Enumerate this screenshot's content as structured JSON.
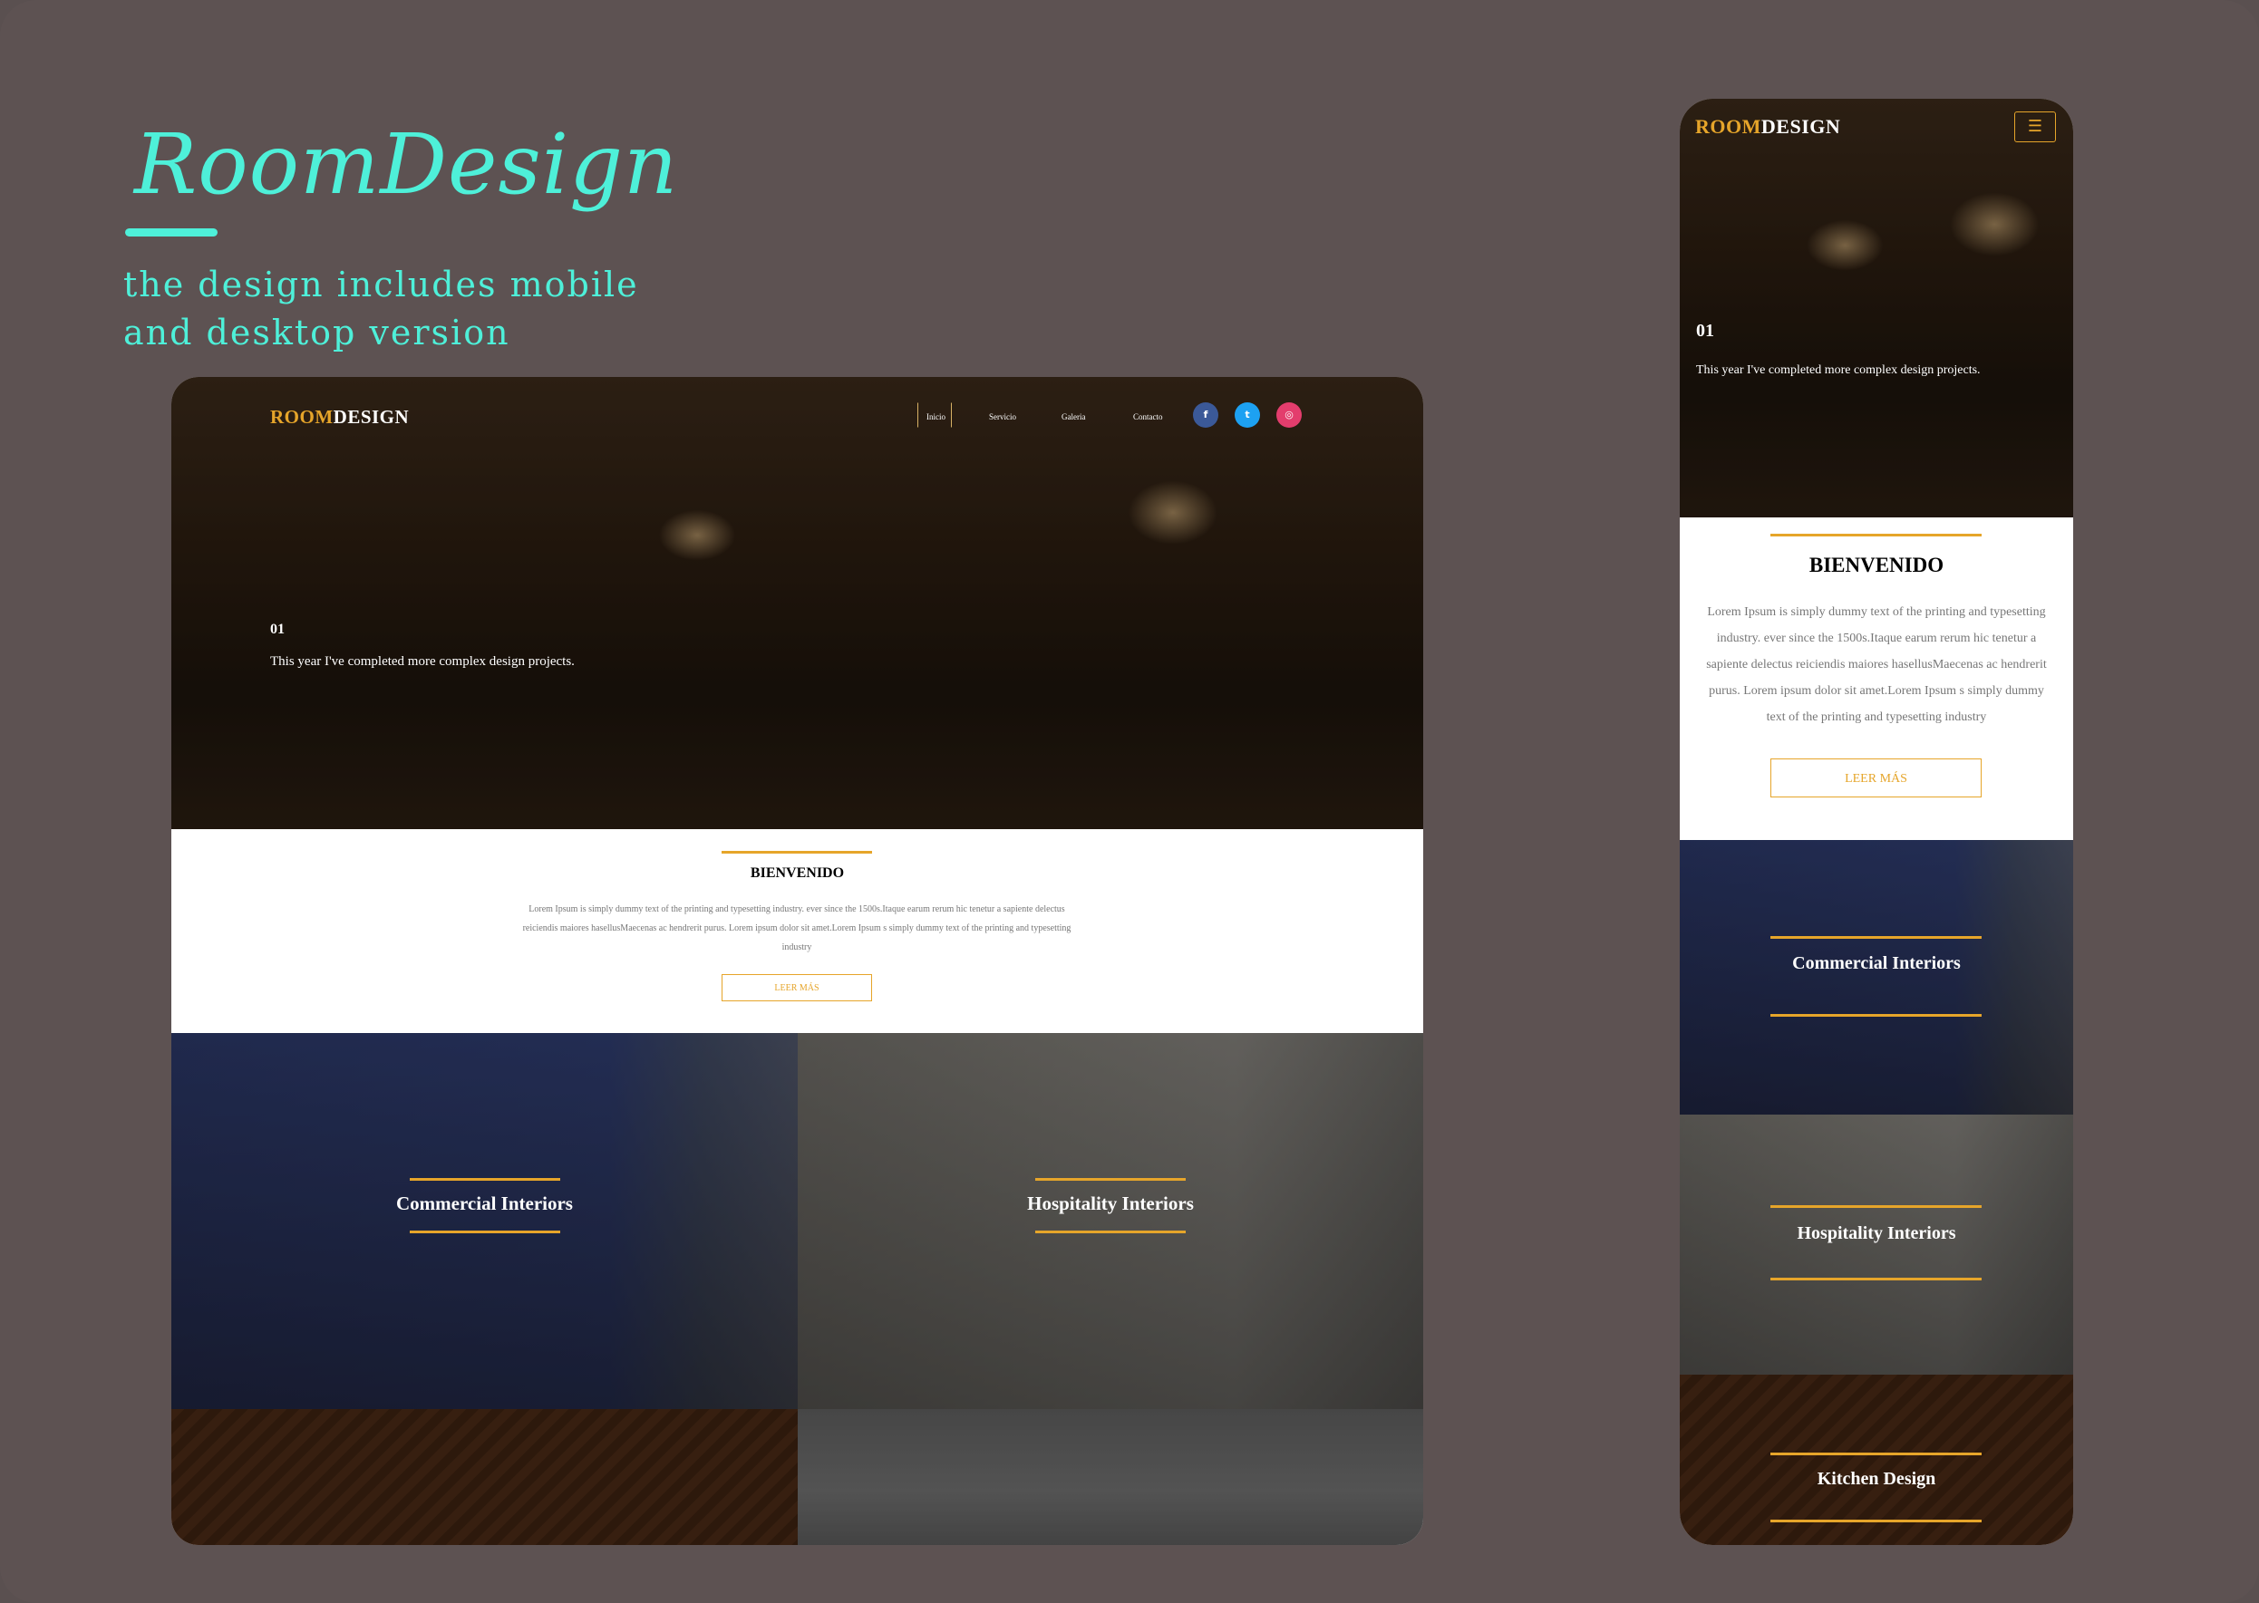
{
  "intro": {
    "brand_script": "RoomDesign",
    "line1": "the design includes mobile",
    "line2": "and desktop version"
  },
  "colors": {
    "background": "#5d5252",
    "accent_teal": "#4ef0d9",
    "accent_gold": "#e6a52a"
  },
  "desktop": {
    "logo_accent": "ROOM",
    "logo_rest": "DESIGN",
    "nav": [
      "Inicio",
      "Servicio",
      "Galeria",
      "Contacto"
    ],
    "social_icons": [
      "facebook-icon",
      "twitter-icon",
      "instagram-icon"
    ],
    "social_glyphs": [
      "f",
      "t",
      "◎"
    ],
    "hero_number": "01",
    "hero_caption": "This year I've completed more complex design projects.",
    "welcome_title": "BIENVENIDO",
    "welcome_body": "Lorem Ipsum is simply dummy text of the printing and typesetting industry. ever since the 1500s.Itaque earum rerum hic tenetur a sapiente delectus reiciendis maiores hasellusMaecenas ac hendrerit purus. Lorem ipsum dolor sit amet.Lorem Ipsum s simply dummy text of the printing and typesetting industry",
    "read_more": "LEER MÁS",
    "tiles": [
      "Commercial Interiors",
      "Hospitality Interiors"
    ]
  },
  "mobile": {
    "logo_accent": "ROOM",
    "logo_rest": "DESIGN",
    "menu_glyph": "☰",
    "hero_number": "01",
    "hero_caption": "This year I've completed more complex design projects.",
    "welcome_title": "BIENVENIDO",
    "welcome_body": "Lorem Ipsum is simply dummy text of the printing and typesetting industry. ever since the 1500s.Itaque earum rerum hic tenetur a sapiente delectus reiciendis maiores hasellusMaecenas ac hendrerit purus. Lorem ipsum dolor sit amet.Lorem Ipsum s simply dummy text of the printing and typesetting industry",
    "read_more": "LEER MÁS",
    "tiles": [
      "Commercial Interiors",
      "Hospitality Interiors",
      "Kitchen Design"
    ]
  }
}
